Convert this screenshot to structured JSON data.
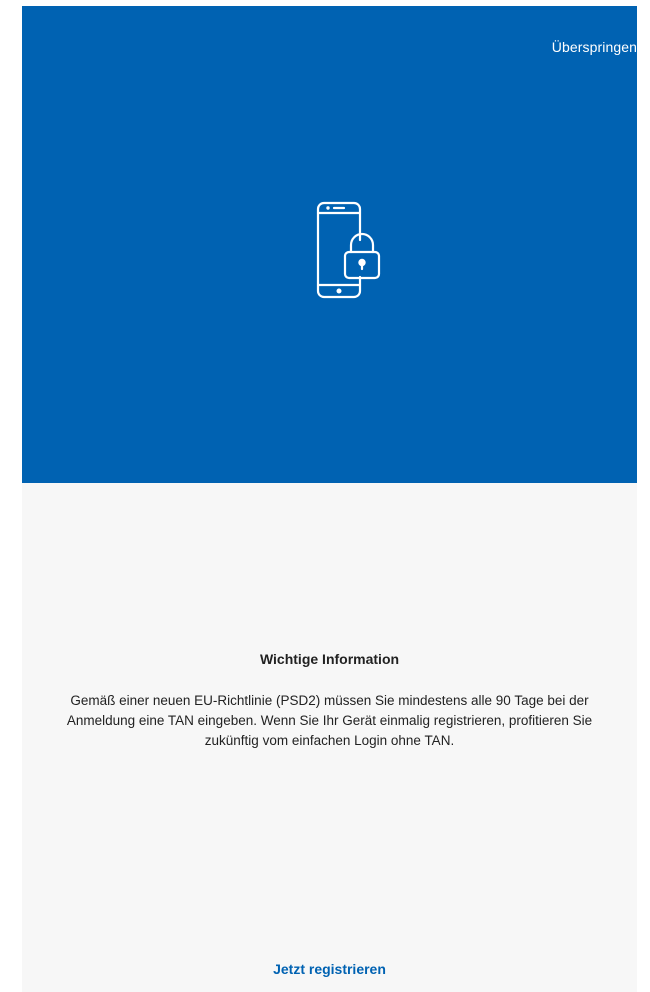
{
  "header": {
    "skip_label": "Überspringen",
    "background_color": "#0062b2",
    "icon": "phone-lock-icon"
  },
  "info": {
    "title": "Wichtige Information",
    "body": "Gemäß einer neuen EU-Richtlinie (PSD2) müssen Sie mindestens alle 90 Tage bei der Anmeldung eine TAN eingeben. Wenn Sie Ihr Gerät einmalig registrieren, profitieren Sie zukünftig vom einfachen Login ohne TAN."
  },
  "footer": {
    "register_label": "Jetzt registrieren",
    "link_color": "#0062b2"
  }
}
